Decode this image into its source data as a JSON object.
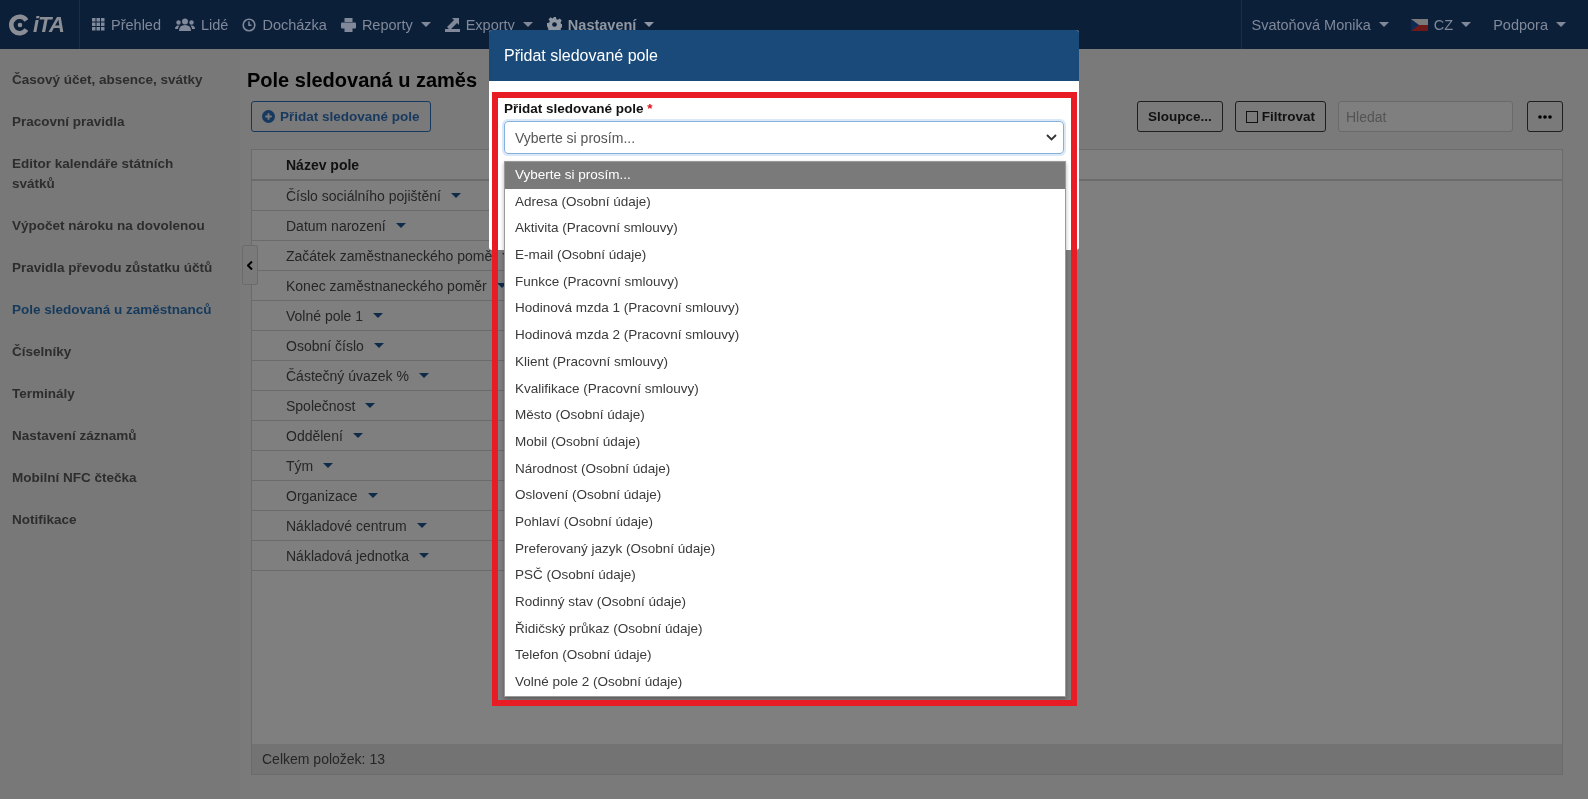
{
  "nav": {
    "logo_text": "iTA",
    "items": [
      {
        "label": "Přehled",
        "dropdown": false,
        "selected": false
      },
      {
        "label": "Lidé",
        "dropdown": false,
        "selected": false
      },
      {
        "label": "Docházka",
        "dropdown": false,
        "selected": false
      },
      {
        "label": "Reporty",
        "dropdown": true,
        "selected": false
      },
      {
        "label": "Exporty",
        "dropdown": true,
        "selected": false
      },
      {
        "label": "Nastavení",
        "dropdown": true,
        "selected": true
      }
    ],
    "user": {
      "label": "Svatoňová Monika"
    },
    "language": {
      "label": "CZ"
    },
    "support": {
      "label": "Podpora"
    }
  },
  "sidebar": {
    "items": [
      {
        "label": "Časový účet, absence, svátky",
        "selected": false
      },
      {
        "label": "Pracovní pravidla",
        "selected": false
      },
      {
        "label": "Editor kalendáře státních svátků",
        "selected": false
      },
      {
        "label": "Výpočet nároku na dovolenou",
        "selected": false
      },
      {
        "label": "Pravidla převodu zůstatku účtů",
        "selected": false
      },
      {
        "label": "Pole sledovaná u zaměstnanců",
        "selected": true
      },
      {
        "label": "Číselníky",
        "selected": false
      },
      {
        "label": "Terminály",
        "selected": false
      },
      {
        "label": "Nastavení záznamů",
        "selected": false
      },
      {
        "label": "Mobilní NFC čtečka",
        "selected": false
      },
      {
        "label": "Notifikace",
        "selected": false
      }
    ]
  },
  "page": {
    "title": "Pole sledovaná u zaměs",
    "add_button": "Přidat sledované pole"
  },
  "toolbar": {
    "columns_button": "Sloupce...",
    "filter_button": {
      "label": "Filtrovat",
      "checked": false
    },
    "search": {
      "placeholder": "Hledat"
    }
  },
  "table": {
    "columns": [
      "Název pole"
    ],
    "rows": [
      {
        "name": "Číslo sociálního pojištění"
      },
      {
        "name": "Datum narození"
      },
      {
        "name": "Začátek zaměstnaneckého pomě"
      },
      {
        "name": "Konec zaměstnaneckého poměr"
      },
      {
        "name": "Volné pole 1"
      },
      {
        "name": "Osobní číslo"
      },
      {
        "name": "Částečný úvazek %"
      },
      {
        "name": "Společnost"
      },
      {
        "name": "Oddělení"
      },
      {
        "name": "Tým"
      },
      {
        "name": "Organizace"
      },
      {
        "name": "Nákladové centrum"
      },
      {
        "name": "Nákladová jednotka"
      }
    ],
    "footer": "Celkem položek: 13"
  },
  "modal": {
    "title": "Přidat sledované pole",
    "field_label": "Přidat sledované pole",
    "required_mark": "*",
    "select_value": "Vyberte si prosím...",
    "options": [
      {
        "label": "Vyberte si prosím...",
        "selected": true
      },
      {
        "label": "Adresa (Osobní údaje)",
        "selected": false
      },
      {
        "label": "Aktivita (Pracovní smlouvy)",
        "selected": false
      },
      {
        "label": "E-mail (Osobní údaje)",
        "selected": false
      },
      {
        "label": "Funkce (Pracovní smlouvy)",
        "selected": false
      },
      {
        "label": "Hodinová mzda 1 (Pracovní smlouvy)",
        "selected": false
      },
      {
        "label": "Hodinová mzda 2 (Pracovní smlouvy)",
        "selected": false
      },
      {
        "label": "Klient (Pracovní smlouvy)",
        "selected": false
      },
      {
        "label": "Kvalifikace (Pracovní smlouvy)",
        "selected": false
      },
      {
        "label": "Město (Osobní údaje)",
        "selected": false
      },
      {
        "label": "Mobil (Osobní údaje)",
        "selected": false
      },
      {
        "label": "Národnost (Osobní údaje)",
        "selected": false
      },
      {
        "label": "Oslovení (Osobní údaje)",
        "selected": false
      },
      {
        "label": "Pohlaví (Osobní údaje)",
        "selected": false
      },
      {
        "label": "Preferovaný jazyk (Osobní údaje)",
        "selected": false
      },
      {
        "label": "PSČ (Osobní údaje)",
        "selected": false
      },
      {
        "label": "Rodinný stav (Osobní údaje)",
        "selected": false
      },
      {
        "label": "Řidičský průkaz (Osobní údaje)",
        "selected": false
      },
      {
        "label": "Telefon (Osobní údaje)",
        "selected": false
      },
      {
        "label": "Volné pole 2 (Osobní údaje)",
        "selected": false
      }
    ]
  }
}
